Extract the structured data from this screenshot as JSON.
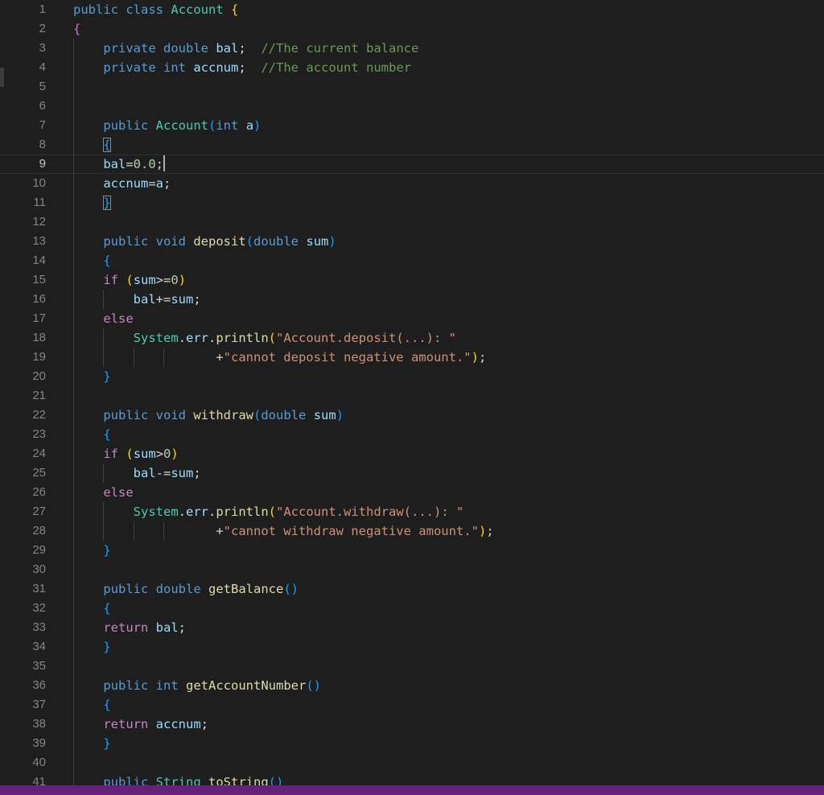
{
  "editor": {
    "language": "java",
    "active_line": "9",
    "lines": [
      {
        "n": "1",
        "tokens": [
          {
            "t": "public",
            "c": "kw"
          },
          {
            "t": " "
          },
          {
            "t": "class",
            "c": "kw"
          },
          {
            "t": " "
          },
          {
            "t": "Account",
            "c": "ty"
          },
          {
            "t": " "
          },
          {
            "t": "{",
            "c": "p1"
          }
        ]
      },
      {
        "n": "2",
        "tokens": [
          {
            "t": "{",
            "c": "p2"
          }
        ]
      },
      {
        "n": "3",
        "tokens": [
          {
            "t": "    "
          },
          {
            "t": "private",
            "c": "kw"
          },
          {
            "t": " "
          },
          {
            "t": "double",
            "c": "kw"
          },
          {
            "t": " "
          },
          {
            "t": "bal",
            "c": "var"
          },
          {
            "t": ";  "
          },
          {
            "t": "//The current balance",
            "c": "com"
          }
        ]
      },
      {
        "n": "4",
        "tokens": [
          {
            "t": "    "
          },
          {
            "t": "private",
            "c": "kw"
          },
          {
            "t": " "
          },
          {
            "t": "int",
            "c": "kw"
          },
          {
            "t": " "
          },
          {
            "t": "accnum",
            "c": "var"
          },
          {
            "t": ";  "
          },
          {
            "t": "//The account number",
            "c": "com"
          }
        ]
      },
      {
        "n": "5",
        "tokens": []
      },
      {
        "n": "6",
        "tokens": []
      },
      {
        "n": "7",
        "tokens": [
          {
            "t": "    "
          },
          {
            "t": "public",
            "c": "kw"
          },
          {
            "t": " "
          },
          {
            "t": "Account",
            "c": "ty"
          },
          {
            "t": "(",
            "c": "p3"
          },
          {
            "t": "int",
            "c": "kw"
          },
          {
            "t": " "
          },
          {
            "t": "a",
            "c": "var"
          },
          {
            "t": ")",
            "c": "p3"
          }
        ]
      },
      {
        "n": "8",
        "tokens": [
          {
            "t": "    "
          },
          {
            "t": "{",
            "c": "p3 bm"
          }
        ]
      },
      {
        "n": "9",
        "tokens": [
          {
            "t": "    "
          },
          {
            "t": "bal",
            "c": "var"
          },
          {
            "t": "="
          },
          {
            "t": "0.0",
            "c": "num"
          },
          {
            "t": ";"
          },
          {
            "t": "",
            "c": "cursor"
          }
        ]
      },
      {
        "n": "10",
        "tokens": [
          {
            "t": "    "
          },
          {
            "t": "accnum",
            "c": "var"
          },
          {
            "t": "="
          },
          {
            "t": "a",
            "c": "var"
          },
          {
            "t": ";"
          }
        ]
      },
      {
        "n": "11",
        "tokens": [
          {
            "t": "    "
          },
          {
            "t": "}",
            "c": "p3 bm"
          }
        ]
      },
      {
        "n": "12",
        "tokens": []
      },
      {
        "n": "13",
        "tokens": [
          {
            "t": "    "
          },
          {
            "t": "public",
            "c": "kw"
          },
          {
            "t": " "
          },
          {
            "t": "void",
            "c": "kw"
          },
          {
            "t": " "
          },
          {
            "t": "deposit",
            "c": "fn"
          },
          {
            "t": "(",
            "c": "p3"
          },
          {
            "t": "double",
            "c": "kw"
          },
          {
            "t": " "
          },
          {
            "t": "sum",
            "c": "var"
          },
          {
            "t": ")",
            "c": "p3"
          }
        ]
      },
      {
        "n": "14",
        "tokens": [
          {
            "t": "    "
          },
          {
            "t": "{",
            "c": "p3"
          }
        ]
      },
      {
        "n": "15",
        "tokens": [
          {
            "t": "    "
          },
          {
            "t": "if",
            "c": "ctl"
          },
          {
            "t": " "
          },
          {
            "t": "(",
            "c": "p1"
          },
          {
            "t": "sum",
            "c": "var"
          },
          {
            "t": ">="
          },
          {
            "t": "0",
            "c": "num"
          },
          {
            "t": ")",
            "c": "p1"
          }
        ]
      },
      {
        "n": "16",
        "tokens": [
          {
            "t": "        "
          },
          {
            "t": "bal",
            "c": "var"
          },
          {
            "t": "+="
          },
          {
            "t": "sum",
            "c": "var"
          },
          {
            "t": ";"
          }
        ]
      },
      {
        "n": "17",
        "tokens": [
          {
            "t": "    "
          },
          {
            "t": "else",
            "c": "ctl"
          }
        ]
      },
      {
        "n": "18",
        "tokens": [
          {
            "t": "        "
          },
          {
            "t": "System",
            "c": "ty"
          },
          {
            "t": "."
          },
          {
            "t": "err",
            "c": "var"
          },
          {
            "t": "."
          },
          {
            "t": "println",
            "c": "fn"
          },
          {
            "t": "(",
            "c": "p1"
          },
          {
            "t": "\"Account.deposit(...): \"",
            "c": "str"
          }
        ]
      },
      {
        "n": "19",
        "tokens": [
          {
            "t": "                   "
          },
          {
            "t": "+"
          },
          {
            "t": "\"cannot deposit negative amount.\"",
            "c": "str"
          },
          {
            "t": ")",
            "c": "p1"
          },
          {
            "t": ";"
          }
        ]
      },
      {
        "n": "20",
        "tokens": [
          {
            "t": "    "
          },
          {
            "t": "}",
            "c": "p3"
          }
        ]
      },
      {
        "n": "21",
        "tokens": []
      },
      {
        "n": "22",
        "tokens": [
          {
            "t": "    "
          },
          {
            "t": "public",
            "c": "kw"
          },
          {
            "t": " "
          },
          {
            "t": "void",
            "c": "kw"
          },
          {
            "t": " "
          },
          {
            "t": "withdraw",
            "c": "fn"
          },
          {
            "t": "(",
            "c": "p3"
          },
          {
            "t": "double",
            "c": "kw"
          },
          {
            "t": " "
          },
          {
            "t": "sum",
            "c": "var"
          },
          {
            "t": ")",
            "c": "p3"
          }
        ]
      },
      {
        "n": "23",
        "tokens": [
          {
            "t": "    "
          },
          {
            "t": "{",
            "c": "p3"
          }
        ]
      },
      {
        "n": "24",
        "tokens": [
          {
            "t": "    "
          },
          {
            "t": "if",
            "c": "ctl"
          },
          {
            "t": " "
          },
          {
            "t": "(",
            "c": "p1"
          },
          {
            "t": "sum",
            "c": "var"
          },
          {
            "t": ">"
          },
          {
            "t": "0",
            "c": "num"
          },
          {
            "t": ")",
            "c": "p1"
          }
        ]
      },
      {
        "n": "25",
        "tokens": [
          {
            "t": "        "
          },
          {
            "t": "bal",
            "c": "var"
          },
          {
            "t": "-="
          },
          {
            "t": "sum",
            "c": "var"
          },
          {
            "t": ";"
          }
        ]
      },
      {
        "n": "26",
        "tokens": [
          {
            "t": "    "
          },
          {
            "t": "else",
            "c": "ctl"
          }
        ]
      },
      {
        "n": "27",
        "tokens": [
          {
            "t": "        "
          },
          {
            "t": "System",
            "c": "ty"
          },
          {
            "t": "."
          },
          {
            "t": "err",
            "c": "var"
          },
          {
            "t": "."
          },
          {
            "t": "println",
            "c": "fn"
          },
          {
            "t": "(",
            "c": "p1"
          },
          {
            "t": "\"Account.withdraw(...): \"",
            "c": "str"
          }
        ]
      },
      {
        "n": "28",
        "tokens": [
          {
            "t": "                   "
          },
          {
            "t": "+"
          },
          {
            "t": "\"cannot withdraw negative amount.\"",
            "c": "str"
          },
          {
            "t": ")",
            "c": "p1"
          },
          {
            "t": ";"
          }
        ]
      },
      {
        "n": "29",
        "tokens": [
          {
            "t": "    "
          },
          {
            "t": "}",
            "c": "p3"
          }
        ]
      },
      {
        "n": "30",
        "tokens": []
      },
      {
        "n": "31",
        "tokens": [
          {
            "t": "    "
          },
          {
            "t": "public",
            "c": "kw"
          },
          {
            "t": " "
          },
          {
            "t": "double",
            "c": "kw"
          },
          {
            "t": " "
          },
          {
            "t": "getBalance",
            "c": "fn"
          },
          {
            "t": "()",
            "c": "p3"
          }
        ]
      },
      {
        "n": "32",
        "tokens": [
          {
            "t": "    "
          },
          {
            "t": "{",
            "c": "p3"
          }
        ]
      },
      {
        "n": "33",
        "tokens": [
          {
            "t": "    "
          },
          {
            "t": "return",
            "c": "ctl"
          },
          {
            "t": " "
          },
          {
            "t": "bal",
            "c": "var"
          },
          {
            "t": ";"
          }
        ]
      },
      {
        "n": "34",
        "tokens": [
          {
            "t": "    "
          },
          {
            "t": "}",
            "c": "p3"
          }
        ]
      },
      {
        "n": "35",
        "tokens": []
      },
      {
        "n": "36",
        "tokens": [
          {
            "t": "    "
          },
          {
            "t": "public",
            "c": "kw"
          },
          {
            "t": " "
          },
          {
            "t": "int",
            "c": "kw"
          },
          {
            "t": " "
          },
          {
            "t": "getAccountNumber",
            "c": "fn"
          },
          {
            "t": "()",
            "c": "p3"
          }
        ]
      },
      {
        "n": "37",
        "tokens": [
          {
            "t": "    "
          },
          {
            "t": "{",
            "c": "p3"
          }
        ]
      },
      {
        "n": "38",
        "tokens": [
          {
            "t": "    "
          },
          {
            "t": "return",
            "c": "ctl"
          },
          {
            "t": " "
          },
          {
            "t": "accnum",
            "c": "var"
          },
          {
            "t": ";"
          }
        ]
      },
      {
        "n": "39",
        "tokens": [
          {
            "t": "    "
          },
          {
            "t": "}",
            "c": "p3"
          }
        ]
      },
      {
        "n": "40",
        "tokens": []
      },
      {
        "n": "41",
        "tokens": [
          {
            "t": "    "
          },
          {
            "t": "public",
            "c": "kw"
          },
          {
            "t": " "
          },
          {
            "t": "String",
            "c": "ty"
          },
          {
            "t": " "
          },
          {
            "t": "toString",
            "c": "fn"
          },
          {
            "t": "()",
            "c": "p3"
          }
        ]
      }
    ]
  },
  "colors": {
    "background": "#1e1e1e",
    "line_number": "#858585",
    "keyword": "#569cd6",
    "control": "#c586c0",
    "type": "#4ec9b0",
    "function": "#dcdcaa",
    "variable": "#9cdcfe",
    "string": "#ce9178",
    "number": "#b5cea8",
    "comment": "#6a9955",
    "statusbar": "#68217a"
  }
}
